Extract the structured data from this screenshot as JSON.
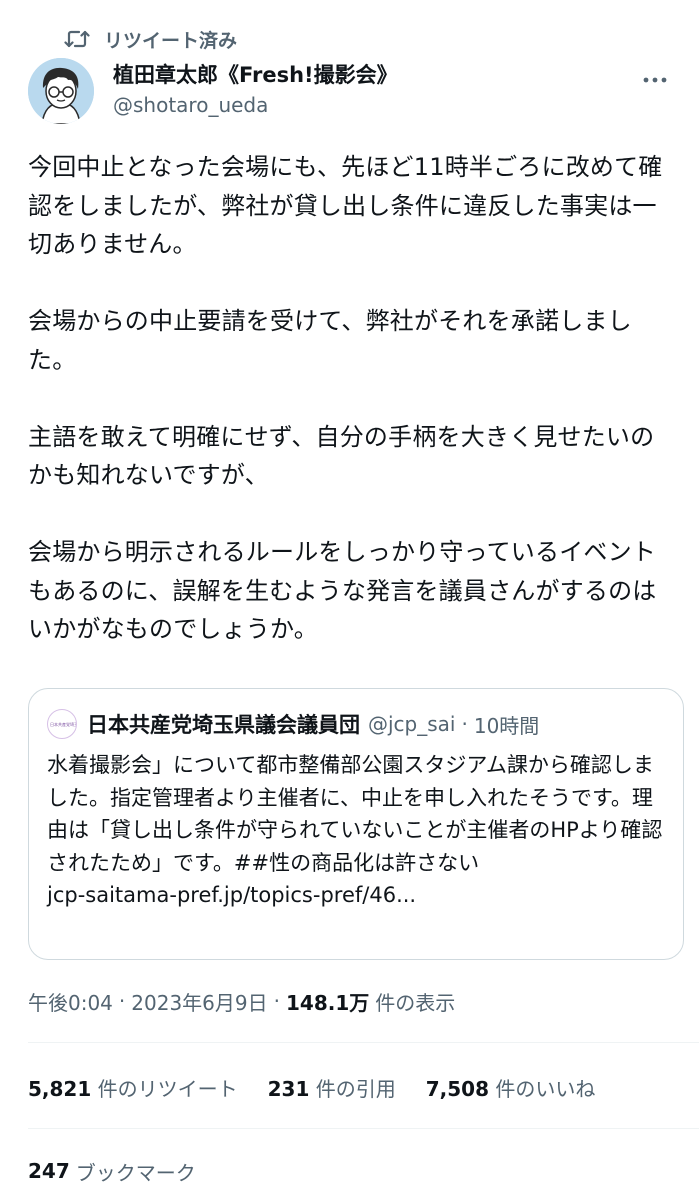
{
  "retweet_label": "リツイート済み",
  "author": {
    "display_name": "植田章太郎《Fresh!撮影会》",
    "handle": "@shotaro_ueda"
  },
  "tweet": {
    "paragraphs": [
      "今回中止となった会場にも、先ほど11時半ごろに改めて確認をしましたが、弊社が貸し出し条件に違反した事実は一切ありません。",
      "会場からの中止要請を受けて、弊社がそれを承諾しました。",
      "主語を敢えて明確にせず、自分の手柄を大きく見せたいのかも知れないですが、",
      "会場から明示されるルールをしっかり守っているイベントもあるのに、誤解を生むような発言を議員さんがするのはいかがなものでしょうか。"
    ]
  },
  "quote": {
    "avatar_text": "日本共産党埼玉県議会議員団",
    "name": "日本共産党埼玉県議会議員団",
    "handle": "@jcp_sai",
    "dot": "·",
    "time": "10時間",
    "text": "水着撮影会」について都市整備部公園スタジアム課から確認しました。指定管理者より主催者に、中止を申し入れたそうです。理由は「貸し出し条件が守られていないことが主催者のHPより確認されたため」です。##性の商品化は許さない",
    "link": "jcp-saitama-pref.jp/topics-pref/46..."
  },
  "meta": {
    "time": "午後0:04",
    "sep1": "·",
    "date": "2023年6月9日",
    "sep2": "·",
    "views_count": "148.1万",
    "views_label": "件の表示"
  },
  "stats": {
    "retweets_count": "5,821",
    "retweets_label": "件のリツイート",
    "quotes_count": "231",
    "quotes_label": "件の引用",
    "likes_count": "7,508",
    "likes_label": "件のいいね"
  },
  "bookmarks": {
    "count": "247",
    "label": "ブックマーク"
  },
  "colors": {
    "text": "#0f1419",
    "secondary": "#536471",
    "border": "#cfd9de",
    "avatar_bg": "#b9d9ee"
  },
  "icons": [
    "retweet-icon",
    "avatar",
    "more-icon"
  ]
}
